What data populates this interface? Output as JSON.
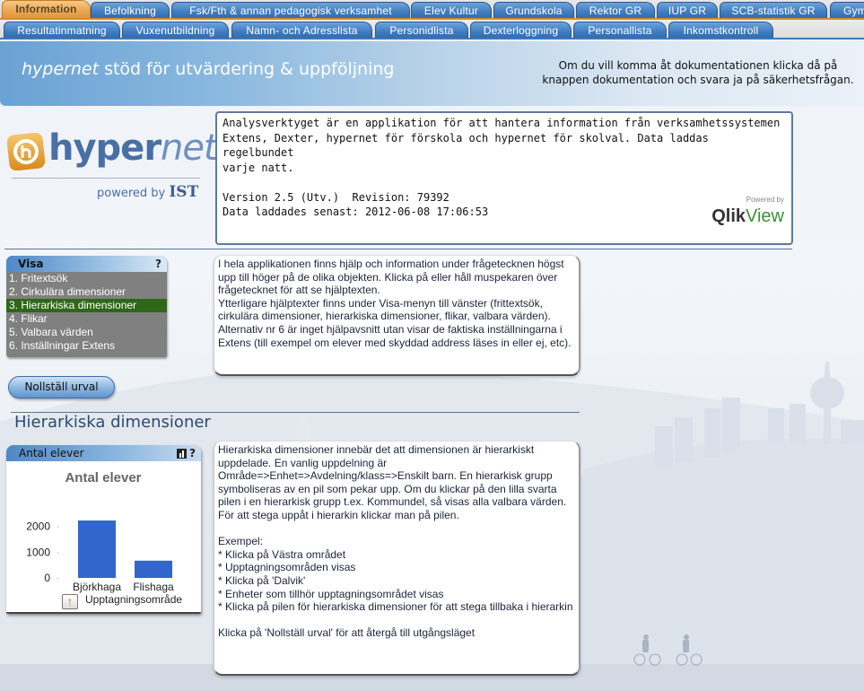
{
  "tabs_row1": [
    {
      "label": "Information",
      "active": true
    },
    {
      "label": "Befolkning"
    },
    {
      "label": "Fsk/Fth & annan pedagogisk verksamhet"
    },
    {
      "label": "Elev Kultur"
    },
    {
      "label": "Grundskola"
    },
    {
      "label": "Rektor GR"
    },
    {
      "label": "IUP GR"
    },
    {
      "label": "SCB-statistik GR"
    },
    {
      "label": "Gym"
    }
  ],
  "tabs_row2": [
    {
      "label": "Resultatinmatning"
    },
    {
      "label": "Vuxenutbildning"
    },
    {
      "label": "Namn- och Adresslista"
    },
    {
      "label": "Personidlista"
    },
    {
      "label": "Dexterloggning"
    },
    {
      "label": "Personallista"
    },
    {
      "label": "Inkomstkontroll"
    }
  ],
  "banner": {
    "title_brand": "hypernet",
    "title_rest": " stöd för utvärdering & uppföljning",
    "doc_note_line1": "Om du vill komma åt dokumentationen klicka då på",
    "doc_note_line2": "knappen dokumentation och svara ja på säkerhetsfrågan."
  },
  "logo": {
    "word_bold": "hyper",
    "word_light": "net",
    "powered_by": "powered by ",
    "powered_brand": "IST"
  },
  "info": {
    "text": "Analysverktyget är en applikation för att hantera information från verksamhetssystemen\nExtens, Dexter, hypernet för förskola och hypernet för skolval. Data laddas regelbundet\nvarje natt.\n\nVersion 2.5 (Utv.)  Revision: 79392\nData laddades senast: 2012-06-08 17:06:53",
    "powered_small": "Powered by",
    "qlik_bold": "Qlik",
    "qlik_light": "View"
  },
  "visa": {
    "title": "Visa",
    "help": "?",
    "items": [
      {
        "label": "1. Fritextsök"
      },
      {
        "label": "2. Cirkulära dimensioner"
      },
      {
        "label": "3. Hierarkiska dimensioner",
        "selected": true
      },
      {
        "label": "4. Flikar"
      },
      {
        "label": "5. Valbara värden"
      },
      {
        "label": "6. Inställningar Extens"
      }
    ]
  },
  "help_text_1": "I hela applikationen finns hjälp och information under frågetecknen högst upp till höger på de olika objekten. Klicka på eller håll muspekaren över frågetecknet för att se hjälptexten.\nYtterligare hjälptexter finns under Visa-menyn till vänster (frittextsök, cirkulära dimensioner, hierarkiska dimensioner, flikar, valbara värden). Alternativ nr 6 är inget hjälpavsnitt utan visar de faktiska inställningarna i Extens (till exempel om elever med skyddad address läses in eller ej, etc).",
  "reset_button": "Nollställ urval",
  "section_title": "Hierarkiska dimensioner",
  "help_text_2": "Hierarkiska dimensioner innebär det att dimensionen är hierarkiskt uppdelade. En vanlig uppdelning är\nOmråde=>Enhet=>Avdelning/klass=>Enskilt barn. En hierarkisk grupp symboliseras av en pil som pekar upp. Om du klickar på den lilla svarta pilen i en hierarkisk grupp t.ex. Kommundel, så visas alla valbara värden. För att stega uppåt i hierarkin klickar man på pilen.\n\nExempel:\n* Klicka på Västra området\n* Upptagningsområden visas\n* Klicka på 'Dalvik'\n* Enheter som tillhör upptagningsområdet visas\n* Klicka på pilen för hierarkiska dimensioner för att stega tillbaka i hierarkin\n\nKlicka på 'Nollställ urval' för att återgå till utgångsläget",
  "chart_object": {
    "caption": "Antal elever",
    "help": "?"
  },
  "chart_data": {
    "type": "bar",
    "title": "Antal elever",
    "categories": [
      "Björkhaga",
      "Flishaga"
    ],
    "values": [
      2230,
      670
    ],
    "xlabel": "Upptagningsområde",
    "ylabel": "",
    "yticks": [
      0,
      1000,
      2000
    ],
    "ylim": [
      0,
      2300
    ],
    "grid": false,
    "bar_color": "#3366cc"
  },
  "colors": {
    "active_tab": "#e9a652",
    "tab": "#3f7cc0",
    "selected_item": "#2f6718",
    "bar": "#3366cc"
  }
}
